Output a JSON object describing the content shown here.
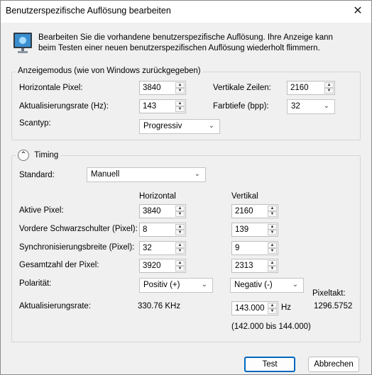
{
  "window": {
    "title": "Benutzerspezifische Auflösung bearbeiten",
    "close_glyph": "✕"
  },
  "description": "Bearbeiten Sie die vorhandene benutzerspezifische Auflösung. Ihre Anzeige kann beim Testen einer neuen benutzerspezifischen Auflösung wiederholt flimmern.",
  "display_mode": {
    "group_title": "Anzeigemodus (wie von Windows zurückgegeben)",
    "horizontal_pixels_label": "Horizontale Pixel:",
    "horizontal_pixels_value": "3840",
    "vertical_lines_label": "Vertikale Zeilen:",
    "vertical_lines_value": "2160",
    "refresh_rate_label": "Aktualisierungsrate (Hz):",
    "refresh_rate_value": "143",
    "color_depth_label": "Farbtiefe (bpp):",
    "color_depth_value": "32",
    "scan_type_label": "Scantyp:",
    "scan_type_value": "Progressiv"
  },
  "timing": {
    "group_title": "Timing",
    "standard_label": "Standard:",
    "standard_value": "Manuell",
    "col_horizontal": "Horizontal",
    "col_vertical": "Vertikal",
    "rows": [
      {
        "label": "Aktive Pixel:",
        "h": "3840",
        "v": "2160"
      },
      {
        "label": "Vordere Schwarzschulter (Pixel):",
        "h": "8",
        "v": "139"
      },
      {
        "label": "Synchronisierungsbreite (Pixel):",
        "h": "32",
        "v": "9"
      },
      {
        "label": "Gesamtzahl der Pixel:",
        "h": "3920",
        "v": "2313"
      }
    ],
    "polarity_label": "Polarität:",
    "polarity_h": "Positiv (+)",
    "polarity_v": "Negativ (-)",
    "pixel_clock_label": "Pixeltakt:",
    "pixel_clock_value": "1296.5752",
    "refresh_label": "Aktualisierungsrate:",
    "refresh_h_value": "330.76 KHz",
    "refresh_v_value": "143.000",
    "refresh_unit": "Hz",
    "refresh_range": "(142.000 bis 144.000)"
  },
  "buttons": {
    "test": "Test",
    "cancel": "Abbrechen"
  },
  "glyphs": {
    "up": "▲",
    "down": "▼",
    "chevron": "⌄",
    "collapse": "⌃"
  }
}
